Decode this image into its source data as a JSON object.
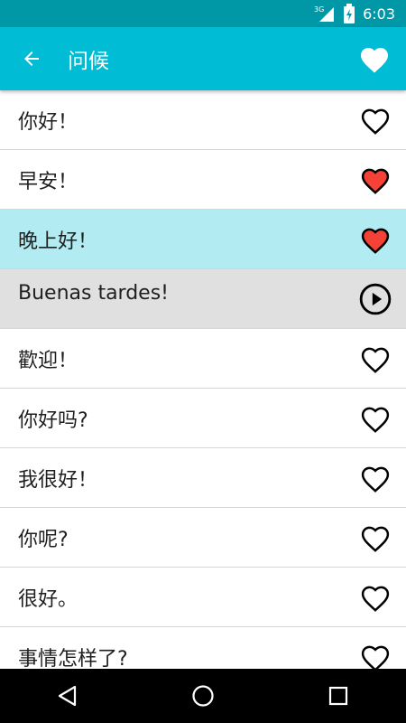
{
  "status_bar": {
    "network": "3G",
    "time": "6:03"
  },
  "app_bar": {
    "title": "问候",
    "back_icon": "arrow-left-icon",
    "favorite_icon": "heart-filled-icon"
  },
  "colors": {
    "status_bar": "#0097a7",
    "app_bar": "#00bcd4",
    "highlight_row": "#b2ebf2",
    "playing_row": "#e0e0e0",
    "heart_red": "#f44336"
  },
  "phrases": [
    {
      "text": "你好！",
      "icon": "heart-outline-icon"
    },
    {
      "text": "早安！",
      "icon": "heart-filled-red-icon"
    },
    {
      "text": "晚上好！",
      "icon": "heart-filled-red-icon",
      "state": "selected"
    },
    {
      "text": "Buenas tardes!",
      "icon": "play-circle-icon",
      "state": "translation"
    },
    {
      "text": "歡迎！",
      "icon": "heart-outline-icon"
    },
    {
      "text": "你好吗?",
      "icon": "heart-outline-icon"
    },
    {
      "text": "我很好！",
      "icon": "heart-outline-icon"
    },
    {
      "text": "你呢?",
      "icon": "heart-outline-icon"
    },
    {
      "text": "很好。",
      "icon": "heart-outline-icon"
    },
    {
      "text": "事情怎样了?",
      "icon": "heart-outline-icon"
    }
  ],
  "nav_bar": {
    "back": "nav-back-icon",
    "home": "nav-home-icon",
    "recents": "nav-recents-icon"
  }
}
